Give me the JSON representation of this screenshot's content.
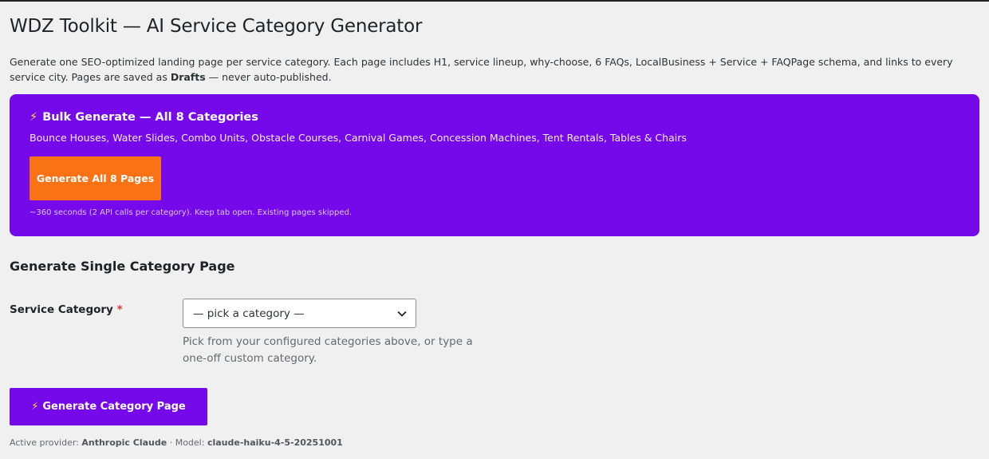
{
  "page": {
    "title": "WDZ Toolkit — AI Service Category Generator",
    "intro_text": "Generate one SEO-optimized landing page per service category. Each page includes H1, service lineup, why-choose, 6 FAQs, LocalBusiness + Service + FAQPage schema, and links to every service city. Pages are saved as ",
    "intro_bold": "Drafts",
    "intro_tail": " — never auto-published."
  },
  "bulk": {
    "icon": "⚡",
    "title": "Bulk Generate — All 8 Categories",
    "categories": "Bounce Houses, Water Slides, Combo Units, Obstacle Courses, Carnival Games, Concession Machines, Tent Rentals, Tables & Chairs",
    "button_label": "Generate All 8 Pages",
    "note": "~360 seconds (2 API calls per category). Keep tab open. Existing pages skipped.",
    "colors": {
      "panel": "#7609ea",
      "button": "#f97316"
    }
  },
  "single": {
    "title": "Generate Single Category Page",
    "field_label": "Service Category",
    "required_mark": "*",
    "select_value": "— pick a category —",
    "help_text": "Pick from your configured categories above, or type a one-off custom category.",
    "button_icon": "⚡",
    "button_label": "Generate Category Page"
  },
  "provider": {
    "prefix": "Active provider: ",
    "name": "Anthropic Claude",
    "separator": " · Model: ",
    "model": "claude-haiku-4-5-20251001"
  }
}
